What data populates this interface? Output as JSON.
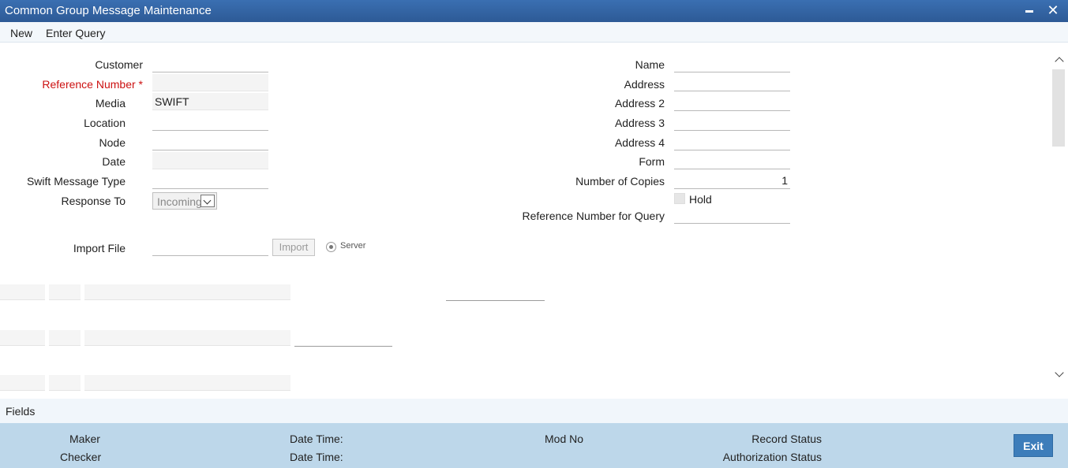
{
  "window": {
    "title": "Common Group Message Maintenance"
  },
  "menu": {
    "new": "New",
    "enter_query": "Enter Query"
  },
  "form": {
    "customer": {
      "label": "Customer",
      "value": ""
    },
    "reference_number": {
      "label": "Reference Number",
      "required_marker": "*",
      "value": ""
    },
    "media": {
      "label": "Media",
      "value": "SWIFT"
    },
    "location": {
      "label": "Location",
      "value": ""
    },
    "node": {
      "label": "Node",
      "value": ""
    },
    "date": {
      "label": "Date",
      "value": ""
    },
    "swift_message_type": {
      "label": "Swift Message Type",
      "value": ""
    },
    "response_to": {
      "label": "Response To",
      "value": "Incoming"
    },
    "import_file": {
      "label": "Import File",
      "value": ""
    },
    "import_button": "Import",
    "server_radio": "Server",
    "name": {
      "label": "Name",
      "value": ""
    },
    "address": {
      "label": "Address",
      "value": ""
    },
    "address2": {
      "label": "Address 2",
      "value": ""
    },
    "address3": {
      "label": "Address 3",
      "value": ""
    },
    "address4": {
      "label": "Address 4",
      "value": ""
    },
    "form_field": {
      "label": "Form",
      "value": ""
    },
    "number_of_copies": {
      "label": "Number of Copies",
      "value": "1"
    },
    "hold": {
      "label": "Hold",
      "checked": false
    },
    "reference_number_for_query": {
      "label": "Reference Number for Query",
      "value": ""
    }
  },
  "fields_tab": "Fields",
  "footer": {
    "maker": "Maker",
    "checker": "Checker",
    "date_time_1": "Date Time:",
    "date_time_2": "Date Time:",
    "mod_no": "Mod No",
    "record_status": "Record Status",
    "authorization_status": "Authorization Status",
    "exit": "Exit"
  },
  "colors": {
    "title_bar": "#2d5a96",
    "required": "#cc1111",
    "footer_bg": "#bdd7ea",
    "exit_button": "#3d7dba"
  }
}
